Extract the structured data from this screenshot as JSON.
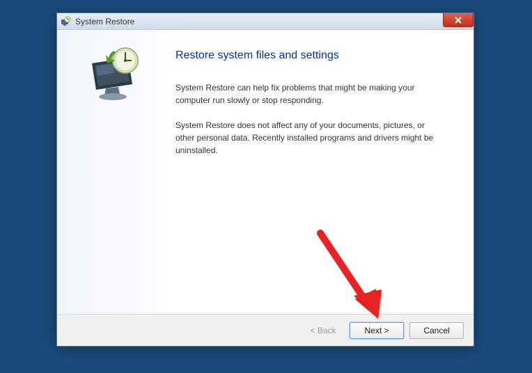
{
  "window": {
    "title": "System Restore"
  },
  "page": {
    "heading": "Restore system files and settings",
    "para1": "System Restore can help fix problems that might be making your computer run slowly or stop responding.",
    "para2": "System Restore does not affect any of your documents, pictures, or other personal data. Recently installed programs and drivers might be uninstalled."
  },
  "buttons": {
    "back": "< Back",
    "next": "Next >",
    "cancel": "Cancel"
  }
}
